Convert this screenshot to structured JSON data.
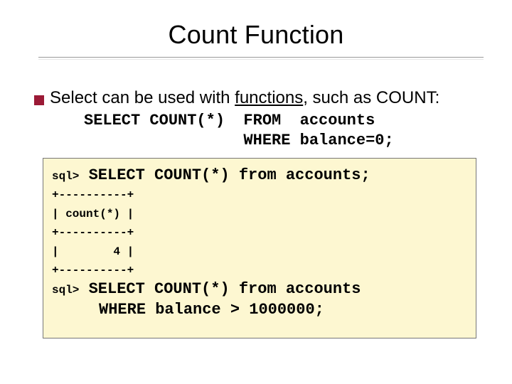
{
  "title": "Count Function",
  "bullet": {
    "pre": "Select can be used with ",
    "underlined": "functions",
    "post": ", such as COUNT:"
  },
  "exampleCode": "SELECT COUNT(*)  FROM  accounts\n                 WHERE balance=0;",
  "sqlBox": {
    "line1": "sql> SELECT COUNT(*) from accounts;",
    "table": "+----------+\n| count(*) |\n+----------+\n|        4 |\n+----------+",
    "line2a": "sql> SELECT COUNT(*) from accounts",
    "line2b": "     WHERE balance > 1000000;"
  }
}
